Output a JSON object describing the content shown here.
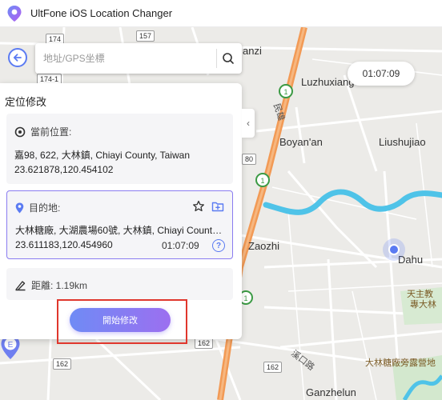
{
  "app": {
    "title": "UltFone iOS Location Changer"
  },
  "search": {
    "placeholder": "地址/GPS坐標"
  },
  "panel": {
    "title": "定位修改",
    "current": {
      "label": "當前位置:",
      "address": "嘉98, 622, 大林鎮, Chiayi County, Taiwan",
      "coords": "23.621878,120.454102"
    },
    "destination": {
      "label": "目的地:",
      "address": "大林糖廠, 大湖農場60號, 大林鎮, Chiayi County, Taiwan",
      "coords": "23.611183,120.454960",
      "time": "01:07:09"
    },
    "distance": {
      "label": "距離: 1.19km"
    },
    "start_button": "開始修改"
  },
  "map": {
    "timer": "01:07:09",
    "places": {
      "anzi": "anzi",
      "luzhuxiang": "Luzhuxiang",
      "boyanan": "Boyan'an",
      "liushujiao": "Liushujiao",
      "zaozhi": "Zaozhi",
      "dahu": "Dahu",
      "ganzhelun": "Ganzhelun",
      "tianzhu_a": "天主教",
      "tianzhu_b": "專大林",
      "dalin_farm": "大林糖廠旁露營地",
      "xikou_road": "溪口路",
      "expressway_label": "民雄"
    },
    "road_signs": {
      "r174": "174",
      "r157": "157",
      "r174_1": "174-1",
      "r162a": "162",
      "r162b": "162",
      "r162c": "162",
      "r180": "80"
    },
    "marker_letter": "E"
  },
  "colors": {
    "accent": "#5b7bf2",
    "highway": "#f29a55",
    "river": "#4fc3e8",
    "highlight_box": "#e0372d"
  }
}
